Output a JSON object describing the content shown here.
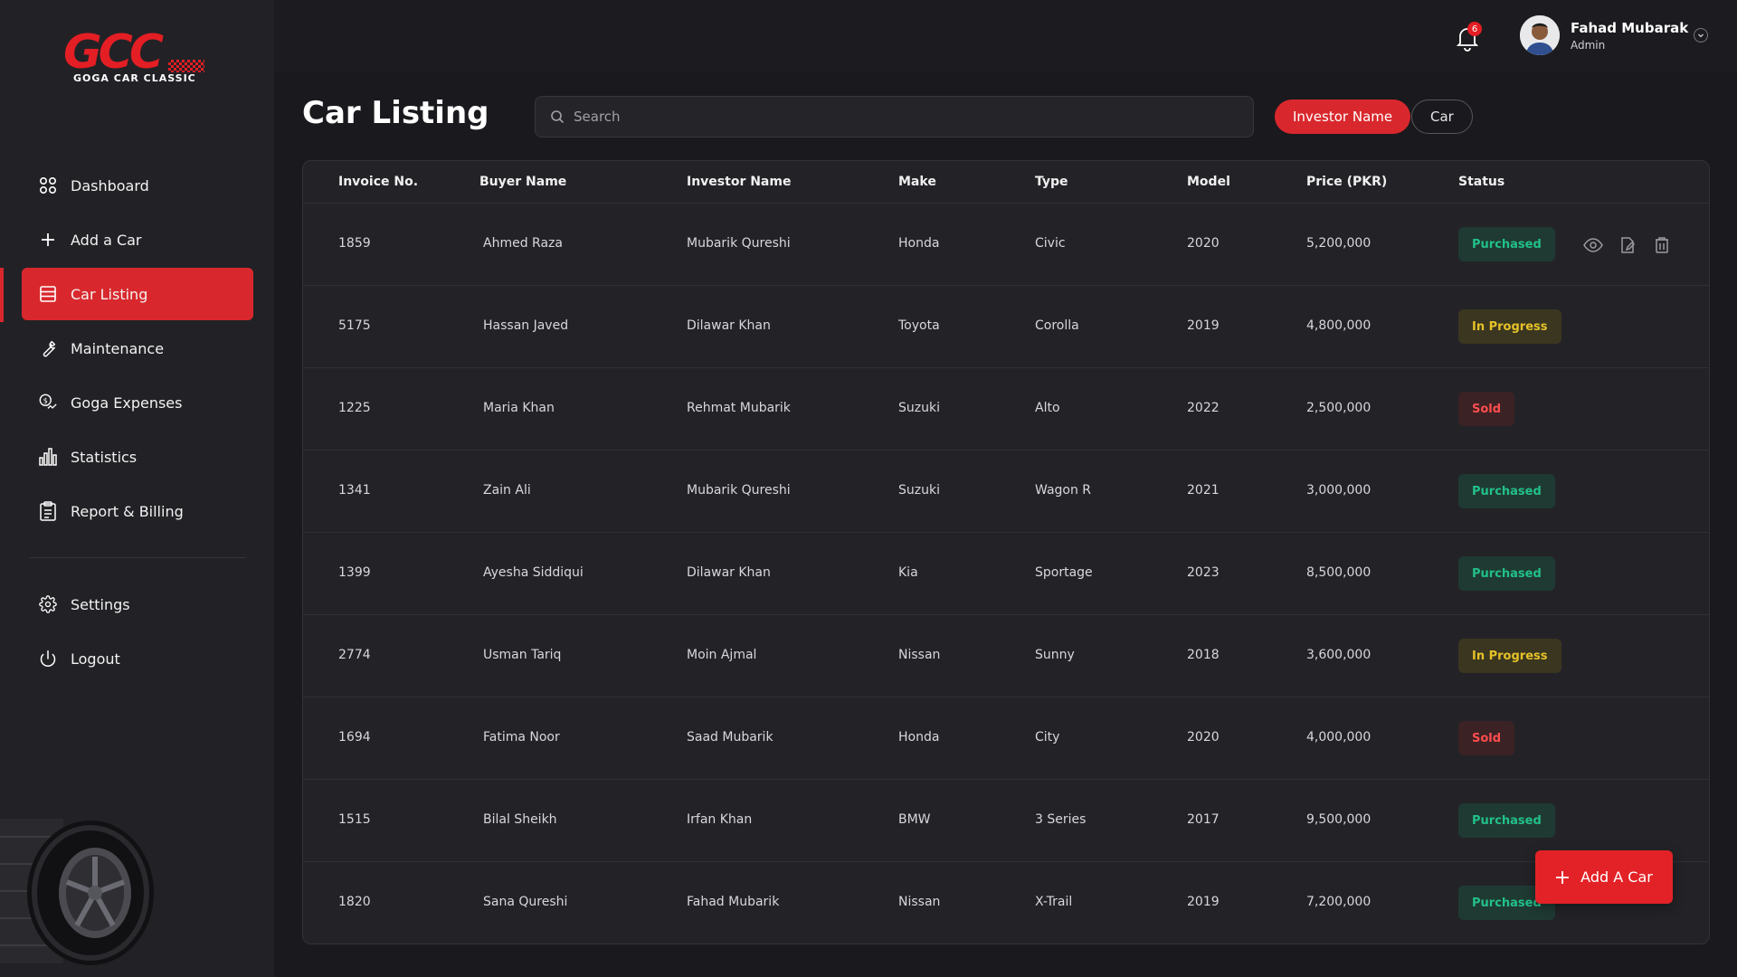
{
  "brand": {
    "logo_mark": "GCC",
    "logo_sub": "GOGA CAR CLASSIC",
    "accent": "#d9282d"
  },
  "sidebar": {
    "items": [
      {
        "label": "Dashboard",
        "icon": "grid-icon"
      },
      {
        "label": "Add a Car",
        "icon": "plus-icon"
      },
      {
        "label": "Car Listing",
        "icon": "list-icon",
        "active": true
      },
      {
        "label": "Maintenance",
        "icon": "wrench-icon"
      },
      {
        "label": "Goga Expenses",
        "icon": "expense-icon"
      },
      {
        "label": "Statistics",
        "icon": "bar-chart-icon"
      },
      {
        "label": "Report & Billing",
        "icon": "clipboard-icon"
      }
    ],
    "bottom_items": [
      {
        "label": "Settings",
        "icon": "gear-icon"
      },
      {
        "label": "Logout",
        "icon": "power-icon"
      }
    ]
  },
  "header": {
    "notification_count": "6",
    "user": {
      "name": "Fahad Mubarak",
      "role": "Admin"
    }
  },
  "main": {
    "title": "Car Listing",
    "search": {
      "placeholder": "Search",
      "value": ""
    },
    "filters": [
      {
        "label": "Investor Name",
        "active": true
      },
      {
        "label": "Car",
        "active": false
      }
    ],
    "table": {
      "columns": [
        "Invoice No.",
        "Buyer Name",
        "Investor Name",
        "Make",
        "Type",
        "Model",
        "Price (PKR)",
        "Status"
      ],
      "rows": [
        {
          "invoice": "1859",
          "buyer": "Ahmed Raza",
          "investor": "Mubarik Qureshi",
          "make": "Honda",
          "type": "Civic",
          "model": "2020",
          "price": "5,200,000",
          "status": "Purchased"
        },
        {
          "invoice": "5175",
          "buyer": "Hassan Javed",
          "investor": "Dilawar Khan",
          "make": "Toyota",
          "type": "Corolla",
          "model": "2019",
          "price": "4,800,000",
          "status": "In Progress"
        },
        {
          "invoice": "1225",
          "buyer": "Maria Khan",
          "investor": "Rehmat Mubarik",
          "make": "Suzuki",
          "type": "Alto",
          "model": "2022",
          "price": "2,500,000",
          "status": "Sold"
        },
        {
          "invoice": "1341",
          "buyer": "Zain Ali",
          "investor": "Mubarik Qureshi",
          "make": "Suzuki",
          "type": "Wagon R",
          "model": "2021",
          "price": "3,000,000",
          "status": "Purchased"
        },
        {
          "invoice": "1399",
          "buyer": "Ayesha Siddiqui",
          "investor": "Dilawar Khan",
          "make": "Kia",
          "type": "Sportage",
          "model": "2023",
          "price": "8,500,000",
          "status": "Purchased"
        },
        {
          "invoice": "2774",
          "buyer": "Usman Tariq",
          "investor": "Moin Ajmal",
          "make": "Nissan",
          "type": "Sunny",
          "model": "2018",
          "price": "3,600,000",
          "status": "In Progress"
        },
        {
          "invoice": "1694",
          "buyer": "Fatima Noor",
          "investor": "Saad Mubarik",
          "make": "Honda",
          "type": "City",
          "model": "2020",
          "price": "4,000,000",
          "status": "Sold"
        },
        {
          "invoice": "1515",
          "buyer": "Bilal Sheikh",
          "investor": "Irfan Khan",
          "make": "BMW",
          "type": "3 Series",
          "model": "2017",
          "price": "9,500,000",
          "status": "Purchased"
        },
        {
          "invoice": "1820",
          "buyer": "Sana Qureshi",
          "investor": "Fahad Mubarik",
          "make": "Nissan",
          "type": "X-Trail",
          "model": "2019",
          "price": "7,200,000",
          "status": "Purchased"
        }
      ]
    },
    "add_button_label": "Add A Car"
  }
}
